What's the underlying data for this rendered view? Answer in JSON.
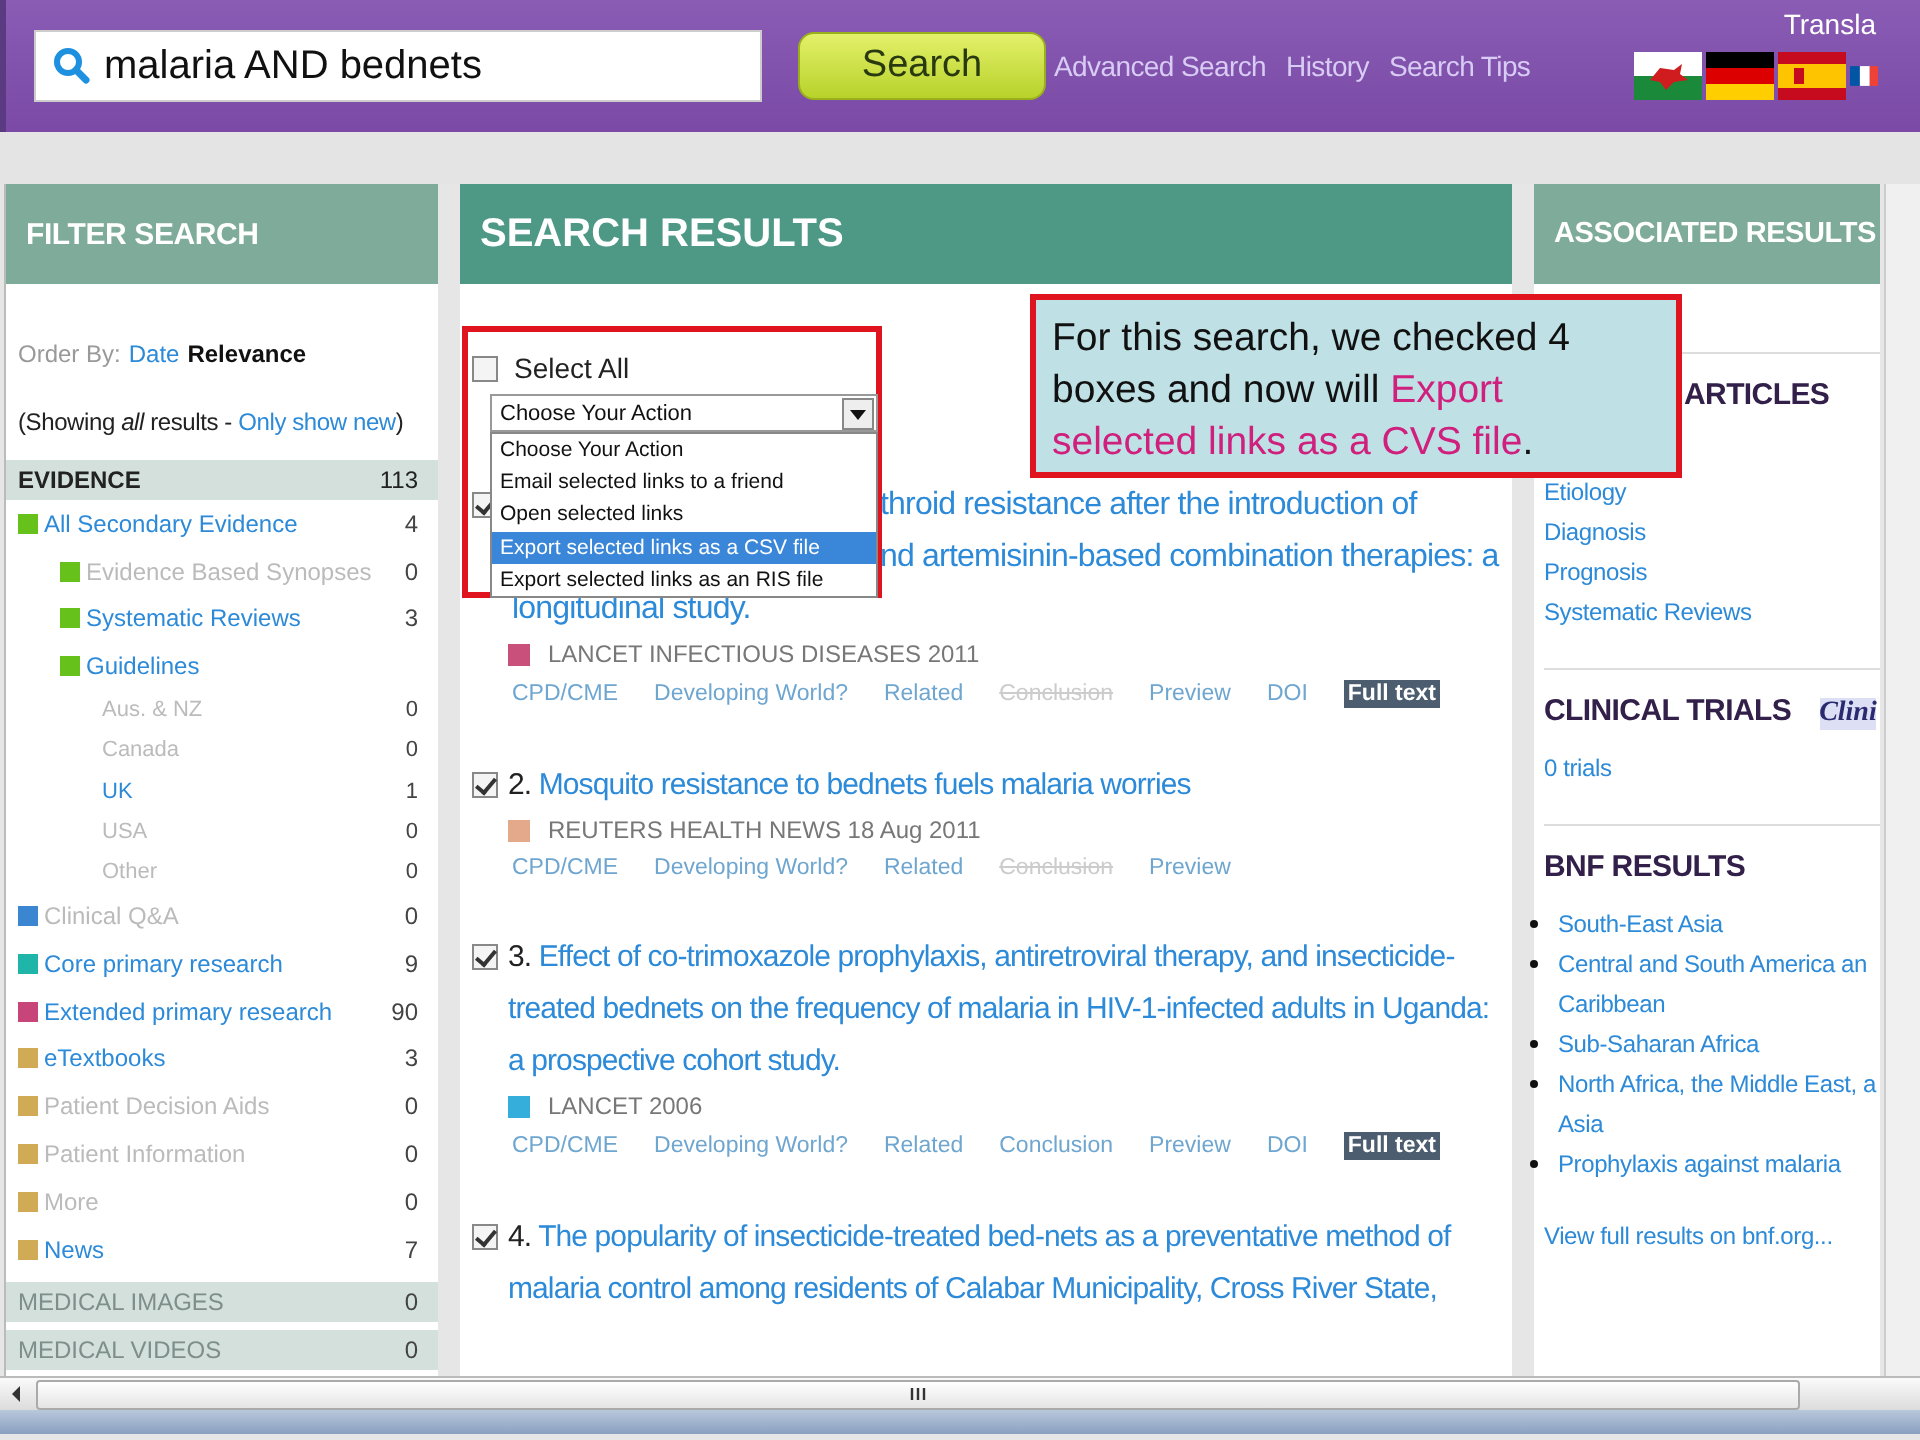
{
  "header": {
    "search_value": "malaria AND bednets",
    "search_button": "Search",
    "links": [
      "Advanced Search",
      "History",
      "Search Tips"
    ],
    "translate_label": "Transla",
    "flags": [
      {
        "kind": "wales"
      },
      {
        "kind": "germany"
      },
      {
        "kind": "spain"
      },
      {
        "kind": "france"
      }
    ]
  },
  "filter": {
    "title": "FILTER SEARCH",
    "order_label": "Order By:",
    "order_options": [
      {
        "label": "Date",
        "selected": false
      },
      {
        "label": "Relevance",
        "selected": true
      }
    ],
    "showing": "(Showing *all* results - ",
    "only_new": "Only show new",
    "showing_end": ")",
    "evidence": {
      "label": "EVIDENCE",
      "count": "113"
    },
    "items": [
      {
        "label": "All Secondary Evidence",
        "count": "4",
        "color": "#66c21a",
        "disabled": false,
        "children": [
          {
            "label": "Evidence Based Synopses",
            "count": "0",
            "color": "#66c21a",
            "disabled": true
          },
          {
            "label": "Systematic Reviews",
            "count": "3",
            "color": "#66c21a",
            "disabled": false
          },
          {
            "label": "Guidelines",
            "color": "#66c21a",
            "disabled": false,
            "children": [
              {
                "label": "Aus. & NZ",
                "count": "0",
                "disabled": true
              },
              {
                "label": "Canada",
                "count": "0",
                "disabled": true
              },
              {
                "label": "UK",
                "count": "1",
                "disabled": false
              },
              {
                "label": "USA",
                "count": "0",
                "disabled": true
              },
              {
                "label": "Other",
                "count": "0",
                "disabled": true
              }
            ]
          }
        ]
      },
      {
        "label": "Clinical Q&A",
        "count": "0",
        "color": "#3a86d0",
        "disabled": true
      },
      {
        "label": "Core primary research",
        "count": "9",
        "color": "#1fb5a8",
        "disabled": false
      },
      {
        "label": "Extended primary research",
        "count": "90",
        "color": "#c8457a",
        "disabled": false
      },
      {
        "label": "eTextbooks",
        "count": "3",
        "color": "#d0aa55",
        "disabled": false
      },
      {
        "label": "Patient Decision Aids",
        "count": "0",
        "color": "#d0aa55",
        "disabled": true
      },
      {
        "label": "Patient Information",
        "count": "0",
        "color": "#d0aa55",
        "disabled": true
      },
      {
        "label": "More",
        "count": "0",
        "color": "#d0aa55",
        "disabled": true
      },
      {
        "label": "News",
        "count": "7",
        "color": "#d0aa55",
        "disabled": false
      }
    ],
    "sections": [
      {
        "label": "MEDICAL IMAGES",
        "count": "0"
      },
      {
        "label": "MEDICAL VIDEOS",
        "count": "0"
      }
    ]
  },
  "results_panel": {
    "title": "SEARCH RESULTS",
    "select_all": {
      "label": "Select All",
      "checked": false
    },
    "action_select": {
      "value": "Choose Your Action",
      "options": [
        {
          "label": "Choose Your Action",
          "highlighted": false
        },
        {
          "label": "Email selected links to a friend",
          "highlighted": false
        },
        {
          "label": "Open selected links",
          "highlighted": false
        },
        {
          "label": "Export selected links as a CSV file",
          "highlighted": true
        },
        {
          "label": "Export selected links as an RIS file",
          "highlighted": false
        }
      ]
    },
    "results": [
      {
        "checked": true,
        "kind": "covered",
        "title_lines": [
          "throid resistance after the introduction of",
          "nd artemisinin-based combination therapies: a",
          "longitudinal study."
        ],
        "source": "LANCET INFECTIOUS DISEASES 2011",
        "color": "#c8507a",
        "links": [
          {
            "label": "CPD/CME",
            "kind": "link",
            "disabled": false
          },
          {
            "label": "Developing World?",
            "kind": "link",
            "disabled": false
          },
          {
            "label": "Related",
            "kind": "link",
            "disabled": false
          },
          {
            "label": "Conclusion",
            "kind": "link",
            "disabled": true
          },
          {
            "label": "Preview",
            "kind": "link",
            "disabled": false
          },
          {
            "label": "DOI",
            "kind": "link",
            "disabled": false
          },
          {
            "label": "Full text",
            "kind": "button"
          }
        ]
      },
      {
        "checked": true,
        "kind": "full",
        "number": "2.",
        "title": "Mosquito resistance to bednets fuels malaria worries",
        "source": "REUTERS HEALTH NEWS 18 Aug 2011",
        "color": "#e3a98a",
        "links": [
          {
            "label": "CPD/CME",
            "kind": "link",
            "disabled": false
          },
          {
            "label": "Developing World?",
            "kind": "link",
            "disabled": false
          },
          {
            "label": "Related",
            "kind": "link",
            "disabled": false
          },
          {
            "label": "Conclusion",
            "kind": "link",
            "disabled": true
          },
          {
            "label": "Preview",
            "kind": "link",
            "disabled": false
          }
        ]
      },
      {
        "checked": true,
        "kind": "full",
        "number": "3.",
        "title": "Effect of co-trimoxazole prophylaxis, antiretroviral therapy, and insecticide-treated bednets on the frequency of malaria in HIV-1-infected adults in Uganda: a prospective cohort study.",
        "source": "LANCET 2006",
        "color": "#35aedb",
        "links": [
          {
            "label": "CPD/CME",
            "kind": "link",
            "disabled": false
          },
          {
            "label": "Developing World?",
            "kind": "link",
            "disabled": false
          },
          {
            "label": "Related",
            "kind": "link",
            "disabled": false
          },
          {
            "label": "Conclusion",
            "kind": "link",
            "disabled": false
          },
          {
            "label": "Preview",
            "kind": "link",
            "disabled": false
          },
          {
            "label": "DOI",
            "kind": "link",
            "disabled": false
          },
          {
            "label": "Full text",
            "kind": "button"
          }
        ]
      },
      {
        "checked": true,
        "kind": "full",
        "number": "4.",
        "title": "The popularity of insecticide-treated bed-nets as a preventative method of malaria control among residents of Calabar Municipality, Cross River State,"
      }
    ]
  },
  "associated": {
    "title": "ASSOCIATED RESULTS",
    "articles": {
      "title": "ARTICLES",
      "items": [
        "Etiology",
        "Diagnosis",
        "Prognosis",
        "Systematic Reviews"
      ]
    },
    "trials": {
      "title": "CLINICAL TRIALS",
      "logo": "Clini",
      "link": "0 trials"
    },
    "bnf": {
      "title": "BNF RESULTS",
      "items": [
        [
          "South-East Asia"
        ],
        [
          "Central and South America an",
          "Caribbean"
        ],
        [
          "Sub-Saharan Africa"
        ],
        [
          "North Africa, the Middle East, a",
          "Asia"
        ],
        [
          "Prophylaxis against malaria"
        ]
      ],
      "more": "View full results on bnf.org..."
    }
  },
  "callout": [
    {
      "text": "For this search, we checked 4 boxes and now will ",
      "highlight": false
    },
    {
      "text": "Export selected links as a CVS file",
      "highlight": true
    },
    {
      "text": ".",
      "highlight": false
    }
  ]
}
